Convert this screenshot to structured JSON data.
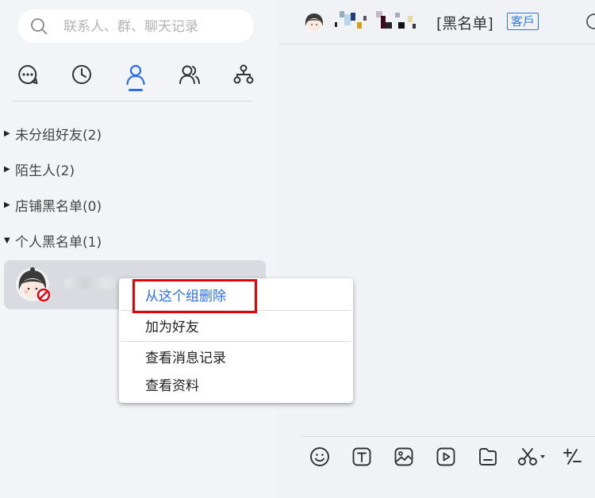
{
  "search": {
    "placeholder": "联系人、群、聊天记录"
  },
  "nav_tabs": [
    {
      "name": "messages",
      "icon": "chat-bubble-icon",
      "active": false
    },
    {
      "name": "recent",
      "icon": "clock-icon",
      "active": false
    },
    {
      "name": "contacts",
      "icon": "person-icon",
      "active": true
    },
    {
      "name": "groups",
      "icon": "people-icon",
      "active": false
    },
    {
      "name": "organization",
      "icon": "org-tree-icon",
      "active": false
    }
  ],
  "groups": [
    {
      "label": "未分组好友(2)",
      "expanded": false
    },
    {
      "label": "陌生人(2)",
      "expanded": false
    },
    {
      "label": "店铺黑名单(0)",
      "expanded": false
    },
    {
      "label": "个人黑名单(1)",
      "expanded": true
    }
  ],
  "context_menu": {
    "items": [
      {
        "label": "从这个组删除",
        "highlighted": true
      },
      {
        "label": "加为好友",
        "highlighted": false
      },
      {
        "label": "查看消息记录",
        "highlighted": false
      },
      {
        "label": "查看资料",
        "highlighted": false
      }
    ]
  },
  "chat": {
    "blacklist_tag": "[黑名单]",
    "customer_tag": "客戶"
  },
  "toolbar": [
    {
      "icon": "emoji-icon"
    },
    {
      "icon": "text-format-icon"
    },
    {
      "icon": "image-icon"
    },
    {
      "icon": "video-icon"
    },
    {
      "icon": "file-icon"
    },
    {
      "icon": "screenshot-scissors-icon"
    },
    {
      "icon": "quick-phrase-icon"
    }
  ],
  "colors": {
    "accent": "#2a6ef0",
    "highlight_border": "#e60000",
    "menu_highlight_text": "#2a6ef0"
  }
}
